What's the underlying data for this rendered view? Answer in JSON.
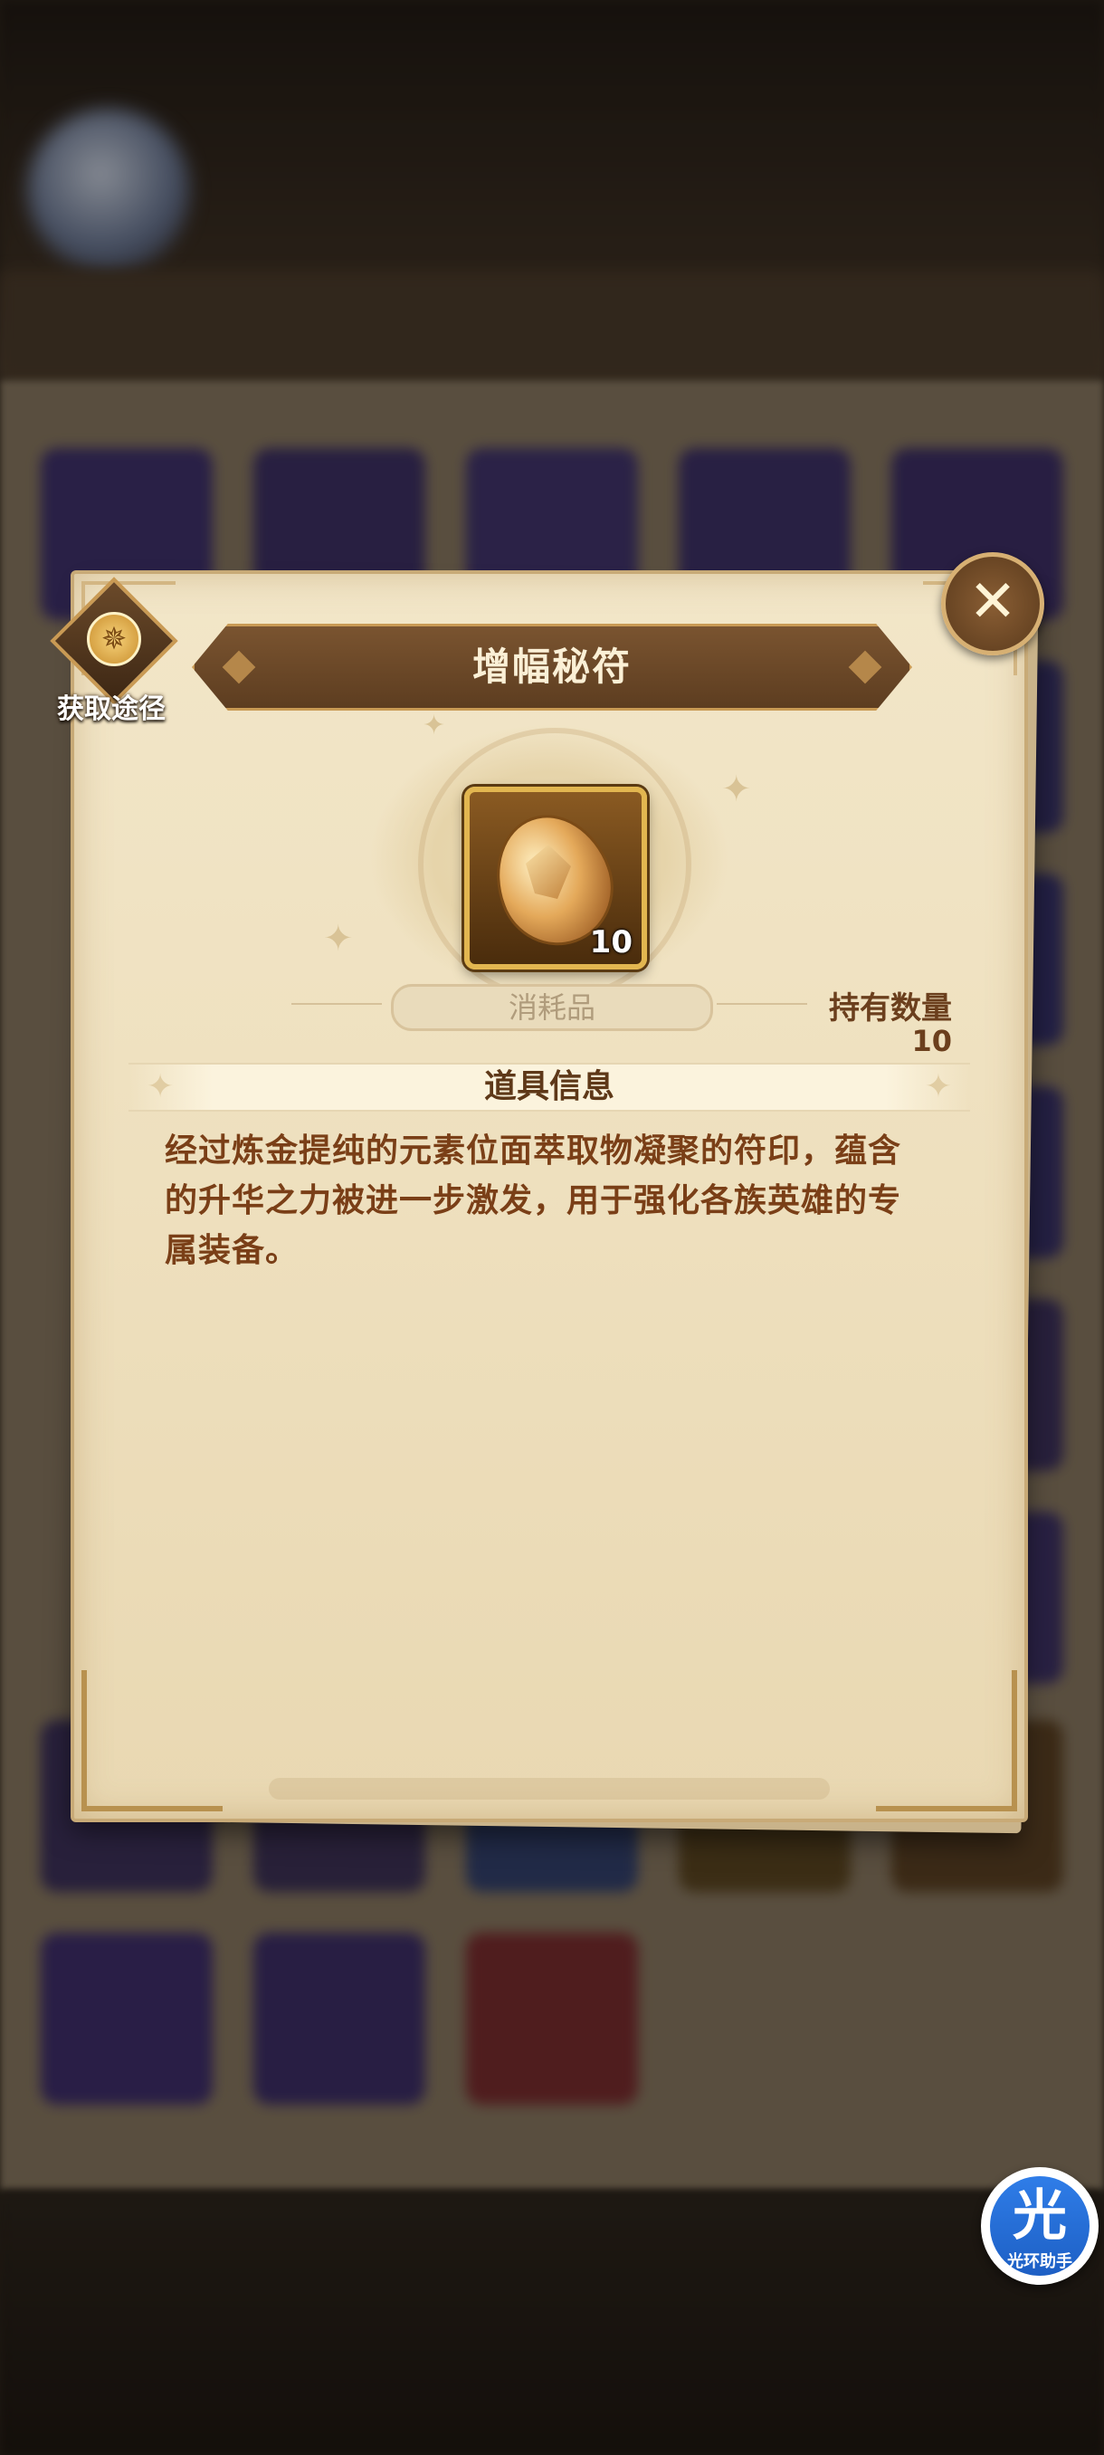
{
  "item": {
    "name": "增幅秘符",
    "count_badge": "10",
    "category": "消耗品",
    "owned_label": "持有数量",
    "owned_value": "10",
    "icon": "amplify-rune-gem-icon"
  },
  "actions": {
    "acquire_label": "获取途径",
    "close_icon": "close-x-icon"
  },
  "section": {
    "title": "道具信息"
  },
  "description": "经过炼金提纯的元素位面萃取物凝聚的符印，蕴含的升华之力被进一步激发，用于强化各族英雄的专属装备。",
  "watermark": {
    "char": "光",
    "text": "光环助手"
  },
  "colors": {
    "parchment": "#efe1c0",
    "banner": "#6b4626",
    "title_text": "#fbf0d6",
    "body_text": "#7a3f17",
    "accent_gold": "#e2b650"
  }
}
